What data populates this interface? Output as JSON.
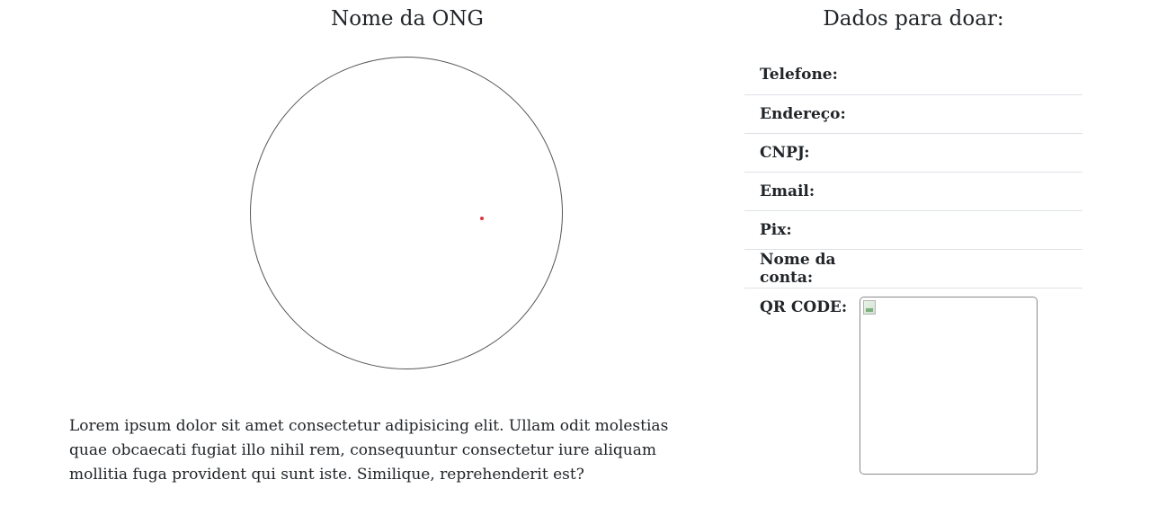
{
  "ong": {
    "title": "Nome da ONG",
    "description": "Lorem ipsum dolor sit amet consectetur adipisicing elit. Ullam odit molestias quae obcaecati fugiat illo nihil rem, consequuntur consectetur iure aliquam mollitia fuga provident qui sunt iste. Similique, reprehenderit est?"
  },
  "donate": {
    "title": "Dados para doar:",
    "rows": [
      {
        "label": "Telefone:",
        "value": ""
      },
      {
        "label": "Endereço:",
        "value": ""
      },
      {
        "label": "CNPJ:",
        "value": ""
      },
      {
        "label": "Email:",
        "value": ""
      },
      {
        "label": "Pix:",
        "value": ""
      },
      {
        "label": "Nome da conta:",
        "value": ""
      }
    ],
    "qr_label": "QR CODE:",
    "qr_icon": "broken-image-icon"
  },
  "colors": {
    "dot": "#dc3545",
    "divider": "#dee2e6"
  }
}
